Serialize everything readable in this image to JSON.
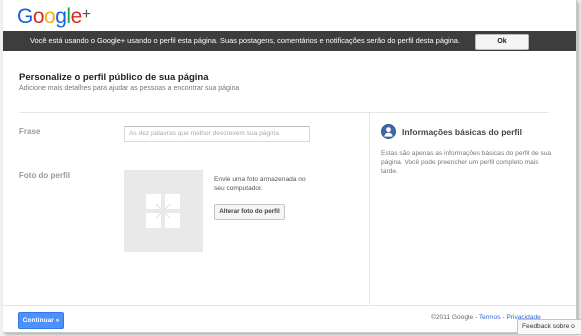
{
  "header": {
    "logo_text": "Google+"
  },
  "notice": {
    "message": "Você está usando o Google+ usando o perfil esta página. Suas postagens, comentários e notificações serão do perfil desta página.",
    "ok_label": "Ok"
  },
  "main": {
    "title": "Personalize o perfil público de sua página",
    "subtitle": "Adicione mais detalhes para ajudar as pessoas a encontrar sua página",
    "frase_label": "Frase",
    "frase_placeholder": "As dez palavras que melhor descrevem sua página",
    "frase_value": "",
    "photo_label": "Foto do perfil",
    "photo_text": "Envie uma foto armazenada no seu computador.",
    "photo_button": "Alterar foto do perfil"
  },
  "info": {
    "title": "Informações básicas do perfil",
    "text": "Estas são apenas as informações básicas do perfil de sua página. Você pode preencher um perfil completo mais tarde."
  },
  "footer": {
    "continue_label": "Continuar »",
    "copyright": "©2011 Google",
    "separator1": " - ",
    "terms": "Termos",
    "separator2": " - ",
    "privacy": "Privacidade",
    "feedback": "Feedback sobre o"
  },
  "colors": {
    "accent": "#4d90fe",
    "notice_bg": "#3d3d3d",
    "link": "#3366cc"
  }
}
